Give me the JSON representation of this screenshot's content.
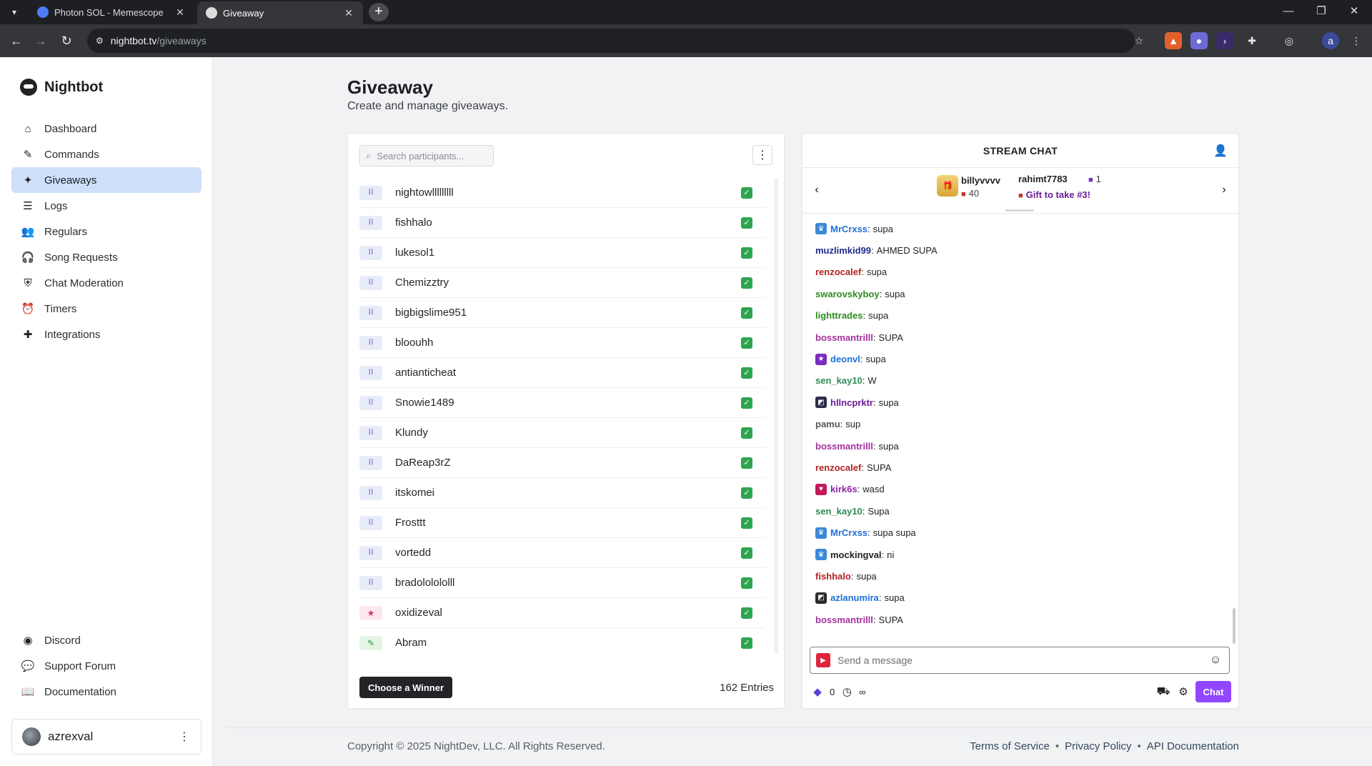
{
  "browser": {
    "tabs": [
      {
        "title": "Photon SOL - Memescope",
        "active": false
      },
      {
        "title": "Giveaway",
        "active": true
      }
    ],
    "url_host": "nightbot.tv",
    "url_path": "/giveaways"
  },
  "sidebar": {
    "brand": "Nightbot",
    "items": [
      {
        "label": "Dashboard",
        "icon": "home-icon"
      },
      {
        "label": "Commands",
        "icon": "wand-icon"
      },
      {
        "label": "Giveaways",
        "icon": "party-icon",
        "active": true
      },
      {
        "label": "Logs",
        "icon": "list-icon"
      },
      {
        "label": "Regulars",
        "icon": "users-icon"
      },
      {
        "label": "Song Requests",
        "icon": "headphones-icon"
      },
      {
        "label": "Chat Moderation",
        "icon": "shield-icon"
      },
      {
        "label": "Timers",
        "icon": "alarm-icon"
      },
      {
        "label": "Integrations",
        "icon": "puzzle-icon"
      }
    ],
    "bottom_items": [
      {
        "label": "Discord",
        "icon": "discord-icon"
      },
      {
        "label": "Support Forum",
        "icon": "forum-icon"
      },
      {
        "label": "Documentation",
        "icon": "book-icon"
      }
    ],
    "user": "azrexval"
  },
  "page": {
    "title": "Giveaway",
    "subtitle": "Create and manage giveaways."
  },
  "giveaway": {
    "search_placeholder": "Search participants...",
    "participants": [
      {
        "name": "nightowlllllllll",
        "badge": "sub"
      },
      {
        "name": "fishhalo",
        "badge": "sub"
      },
      {
        "name": "lukesol1",
        "badge": "sub"
      },
      {
        "name": "Chemizztry",
        "badge": "sub"
      },
      {
        "name": "bigbigslime951",
        "badge": "sub"
      },
      {
        "name": "bloouhh",
        "badge": "sub"
      },
      {
        "name": "antianticheat",
        "badge": "sub"
      },
      {
        "name": "Snowie1489",
        "badge": "sub"
      },
      {
        "name": "Klundy",
        "badge": "sub"
      },
      {
        "name": "DaReap3rZ",
        "badge": "sub"
      },
      {
        "name": "itskomei",
        "badge": "sub"
      },
      {
        "name": "Frosttt",
        "badge": "sub"
      },
      {
        "name": "vortedd",
        "badge": "sub"
      },
      {
        "name": "bradololololll",
        "badge": "sub"
      },
      {
        "name": "oxidizeval",
        "badge": "star"
      },
      {
        "name": "Abram",
        "badge": "pen"
      }
    ],
    "choose_label": "Choose a Winner",
    "entries_label": "162 Entries"
  },
  "chat": {
    "title": "STREAM CHAT",
    "pinned": {
      "user1": "billyvvvv",
      "count1": "40",
      "user2": "rahimt7783",
      "count2": "1",
      "gift_text": "Gift to take #3!"
    },
    "messages": [
      {
        "user": "MrCrxss",
        "text": "supa",
        "color": "#1e6fd9",
        "badge": "crown",
        "badge_color": "#3b88d8"
      },
      {
        "user": "muzlimkid99",
        "text": "AHMED SUPA",
        "color": "#1f2a8a",
        "badge": ""
      },
      {
        "user": "renzocalef",
        "text": "supa",
        "color": "#b22222",
        "badge": ""
      },
      {
        "user": "swarovskyboy",
        "text": "supa",
        "color": "#2e8b1f",
        "badge": ""
      },
      {
        "user": "lighttrades",
        "text": "supa",
        "color": "#2e8b1f",
        "badge": ""
      },
      {
        "user": "bossmantrilll",
        "text": "SUPA",
        "color": "#a3319e",
        "badge": ""
      },
      {
        "user": "deonvl",
        "text": "supa",
        "color": "#1e6fd9",
        "badge": "star",
        "badge_color": "#7b2cbf"
      },
      {
        "user": "sen_kay10",
        "text": "W",
        "color": "#2e8b57",
        "badge": ""
      },
      {
        "user": "hllncprktr",
        "text": "supa",
        "color": "#6a1b9a",
        "badge": "pic",
        "badge_color": "#2b2b4a"
      },
      {
        "user": "pamu",
        "text": "sup",
        "color": "#555555",
        "badge": ""
      },
      {
        "user": "bossmantrilll",
        "text": "supa",
        "color": "#a3319e",
        "badge": ""
      },
      {
        "user": "renzocalef",
        "text": "SUPA",
        "color": "#b22222",
        "badge": ""
      },
      {
        "user": "kirk6s",
        "text": "wasd",
        "color": "#8e24aa",
        "badge": "heart",
        "badge_color": "#c2185b"
      },
      {
        "user": "sen_kay10",
        "text": "Supa",
        "color": "#2e8b57",
        "badge": ""
      },
      {
        "user": "MrCrxss",
        "text": "supa supa",
        "color": "#1e6fd9",
        "badge": "crown",
        "badge_color": "#3b88d8"
      },
      {
        "user": "mockingval",
        "text": "ni",
        "color": "#222222",
        "badge": "crown",
        "badge_color": "#3b88d8"
      },
      {
        "user": "fishhalo",
        "text": "supa",
        "color": "#b22222",
        "badge": ""
      },
      {
        "user": "azlanumira",
        "text": "supa",
        "color": "#1e6fd9",
        "badge": "pic",
        "badge_color": "#2b2b2b"
      },
      {
        "user": "bossmantrilll",
        "text": "SUPA",
        "color": "#a3319e",
        "badge": ""
      }
    ],
    "input_placeholder": "Send a message",
    "points": "0",
    "infinity": "∞",
    "chat_button": "Chat"
  },
  "footer": {
    "copyright": "Copyright © 2025 NightDev, LLC. All Rights Reserved.",
    "links": [
      "Terms of Service",
      "Privacy Policy",
      "API Documentation"
    ]
  }
}
